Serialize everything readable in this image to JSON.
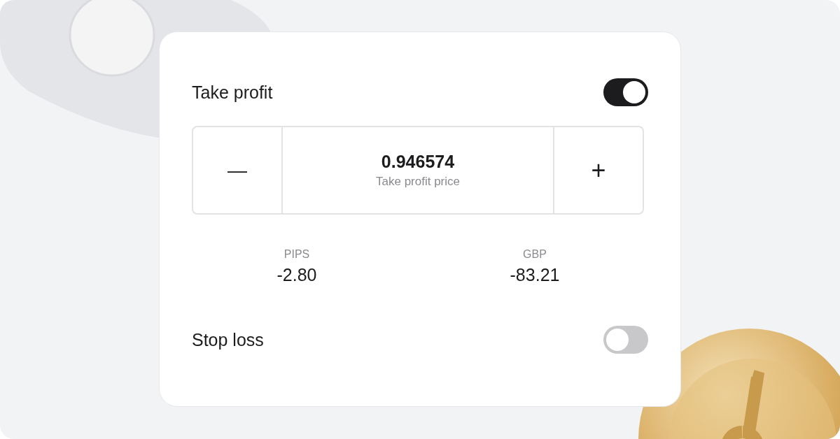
{
  "take_profit": {
    "label": "Take profit",
    "on": true
  },
  "stepper": {
    "decrement": "—",
    "value": "0.946574",
    "label": "Take profit price",
    "increment": "+"
  },
  "stats": [
    {
      "label": "PIPS",
      "value": "-2.80"
    },
    {
      "label": "GBP",
      "value": "-83.21"
    }
  ],
  "stop_loss": {
    "label": "Stop loss",
    "on": false
  }
}
